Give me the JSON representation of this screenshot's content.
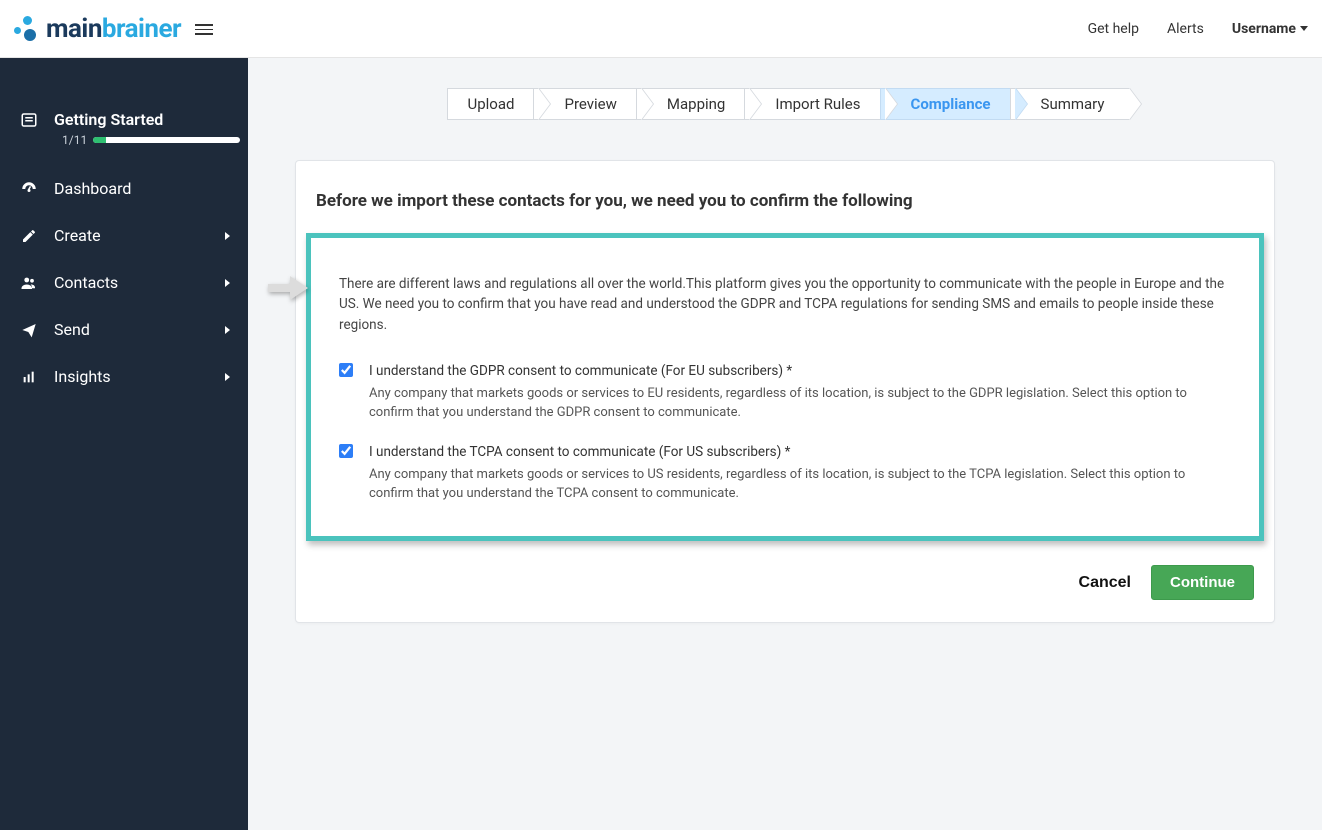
{
  "header": {
    "logo_main": "main",
    "logo_accent": "brainer",
    "get_help": "Get help",
    "alerts": "Alerts",
    "username": "Username"
  },
  "sidebar": {
    "getting_started": {
      "label": "Getting Started",
      "count": "1/11",
      "progress_pct": 9
    },
    "items": [
      {
        "label": "Dashboard",
        "has_children": false
      },
      {
        "label": "Create",
        "has_children": true
      },
      {
        "label": "Contacts",
        "has_children": true
      },
      {
        "label": "Send",
        "has_children": true
      },
      {
        "label": "Insights",
        "has_children": true
      }
    ]
  },
  "wizard": {
    "steps": [
      "Upload",
      "Preview",
      "Mapping",
      "Import Rules",
      "Compliance",
      "Summary"
    ],
    "active_index": 4
  },
  "card": {
    "heading": "Before we import these contacts for you, we need you to confirm the following",
    "intro": "There are different laws and regulations all over the world.This platform gives you the opportunity to communicate with the people in Europe and the US. We need you to confirm that you have read and understood the GDPR and TCPA regulations for sending SMS and emails to people inside these regions.",
    "consents": [
      {
        "checked": true,
        "label": "I understand the GDPR consent to communicate (For EU subscribers) *",
        "desc": "Any company that markets goods or services to EU residents, regardless of its location, is subject to the GDPR legislation. Select this option to confirm that you understand the GDPR consent to communicate."
      },
      {
        "checked": true,
        "label": "I understand the TCPA consent to communicate (For US subscribers) *",
        "desc": "Any company that markets goods or services to US residents, regardless of its location, is subject to the TCPA legislation. Select this option to confirm that you understand the TCPA consent to communicate."
      }
    ],
    "cancel": "Cancel",
    "continue": "Continue"
  }
}
